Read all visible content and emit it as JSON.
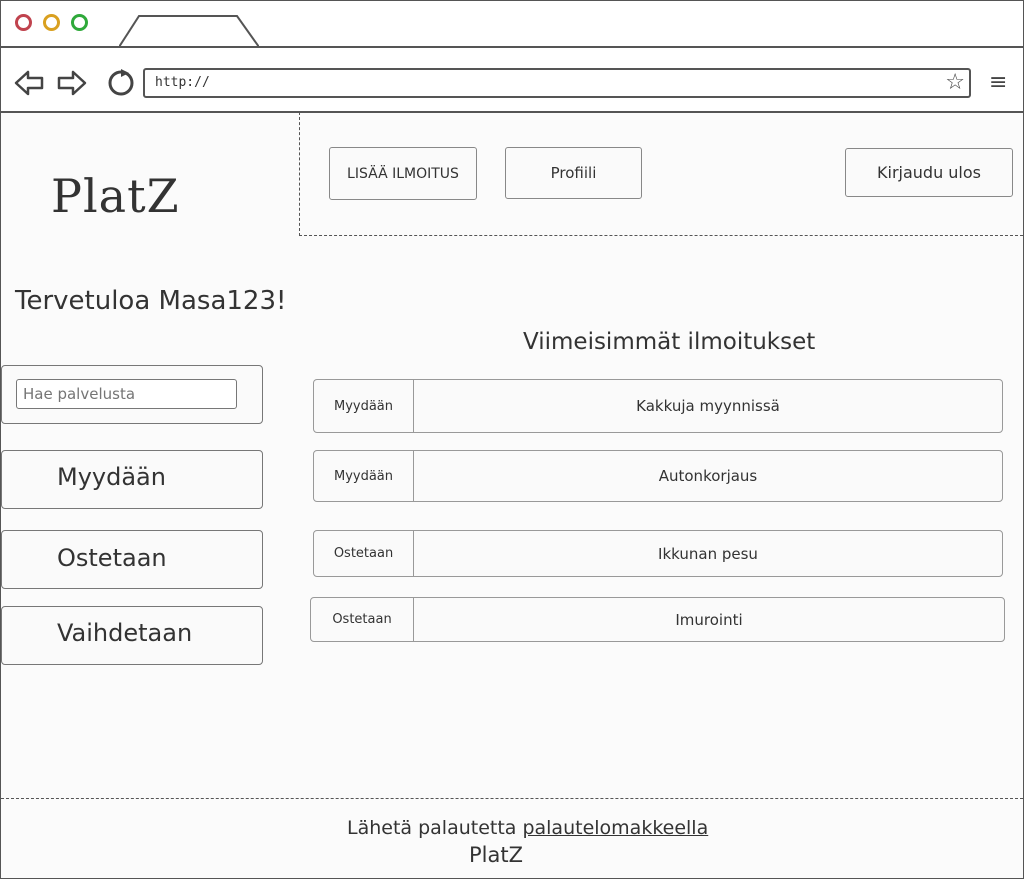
{
  "browser": {
    "url": "http://",
    "back_icon": "back-arrow-icon",
    "forward_icon": "forward-arrow-icon",
    "reload_icon": "reload-icon",
    "bookmark_icon": "star-icon",
    "menu_icon": "hamburger-menu-icon"
  },
  "header": {
    "logo": "PlatZ",
    "add_listing_label": "LISÄÄ ILMOITUS",
    "profile_label": "Profiili",
    "logout_label": "Kirjaudu ulos"
  },
  "sidebar": {
    "welcome": "Tervetuloa Masa123!",
    "search_placeholder": "Hae palvelusta",
    "categories": [
      "Myydään",
      "Ostetaan",
      "Vaihdetaan"
    ]
  },
  "main": {
    "title": "Viimeisimmät ilmoitukset",
    "listings": [
      {
        "category": "Myydään",
        "title": "Kakkuja myynnissä"
      },
      {
        "category": "Myydään",
        "title": "Autonkorjaus"
      },
      {
        "category": "Ostetaan",
        "title": "Ikkunan pesu"
      },
      {
        "category": "Ostetaan",
        "title": "Imurointi"
      }
    ]
  },
  "footer": {
    "text": "Lähetä palautetta",
    "link": "palautelomakkeella",
    "brand": "PlatZ"
  }
}
